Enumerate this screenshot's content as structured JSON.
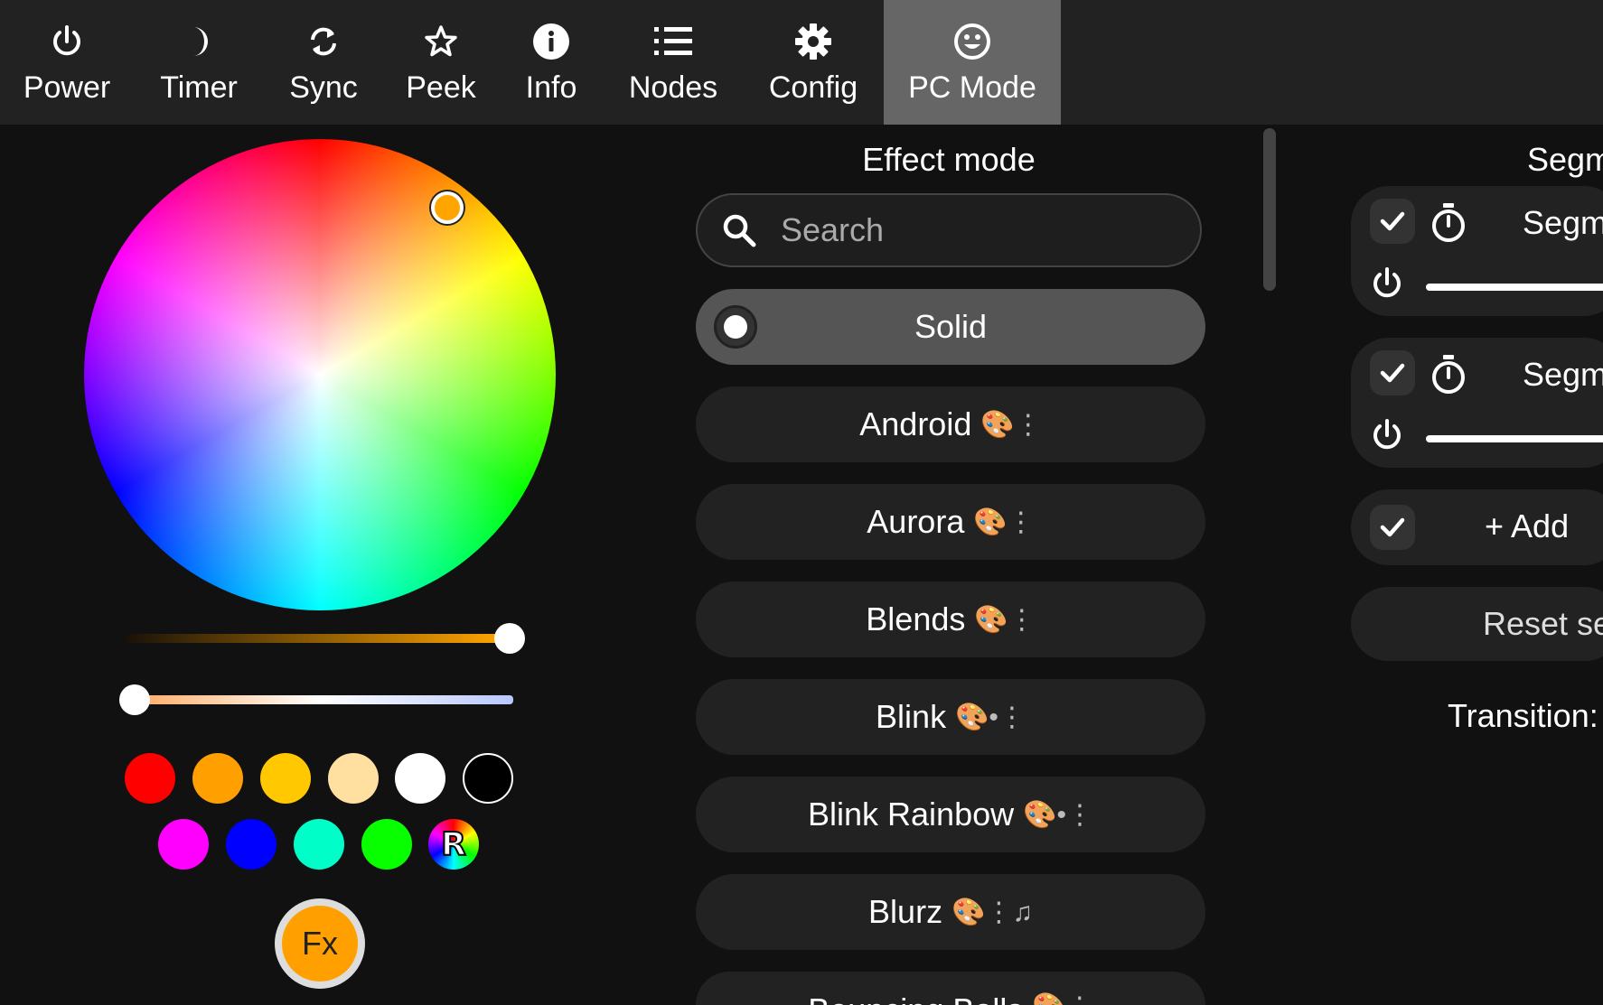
{
  "nav": {
    "tabs": [
      {
        "label": "Power",
        "icon": "power-icon"
      },
      {
        "label": "Timer",
        "icon": "moon-icon"
      },
      {
        "label": "Sync",
        "icon": "sync-icon"
      },
      {
        "label": "Peek",
        "icon": "star-icon"
      },
      {
        "label": "Info",
        "icon": "info-icon"
      },
      {
        "label": "Nodes",
        "icon": "list-icon"
      },
      {
        "label": "Config",
        "icon": "gear-icon"
      },
      {
        "label": "PC Mode",
        "icon": "smiley-icon",
        "active": true
      }
    ]
  },
  "color_picker": {
    "selected_color": "#ffa500",
    "brightness_level": 1.0,
    "white_balance_level": 0.0,
    "quick_colors": [
      "#ff0000",
      "#ffa000",
      "#ffc800",
      "#ffe0a0",
      "#ffffff",
      "#000000",
      "#ff00ff",
      "#0000ff",
      "#00ffc8",
      "#08ff00"
    ],
    "random_label": "R",
    "fx_label": "Fx"
  },
  "effects": {
    "title": "Effect mode",
    "search_placeholder": "Search",
    "items": [
      {
        "name": "Solid",
        "flags": "",
        "selected": true
      },
      {
        "name": "Android",
        "flags": "🎨⋮"
      },
      {
        "name": "Aurora",
        "flags": "🎨⋮"
      },
      {
        "name": "Blends",
        "flags": "🎨⋮"
      },
      {
        "name": "Blink",
        "flags": "🎨•⋮"
      },
      {
        "name": "Blink Rainbow",
        "flags": "🎨•⋮"
      },
      {
        "name": "Blurz",
        "flags": "🎨⋮♫"
      },
      {
        "name": "Bouncing Balls",
        "flags": "🎨⋮"
      }
    ]
  },
  "segments": {
    "title": "Segm",
    "items": [
      {
        "name": "Segm"
      },
      {
        "name": "Segm"
      }
    ],
    "add_label": "+ Add",
    "reset_label": "Reset se",
    "transition_label": "Transition:"
  }
}
